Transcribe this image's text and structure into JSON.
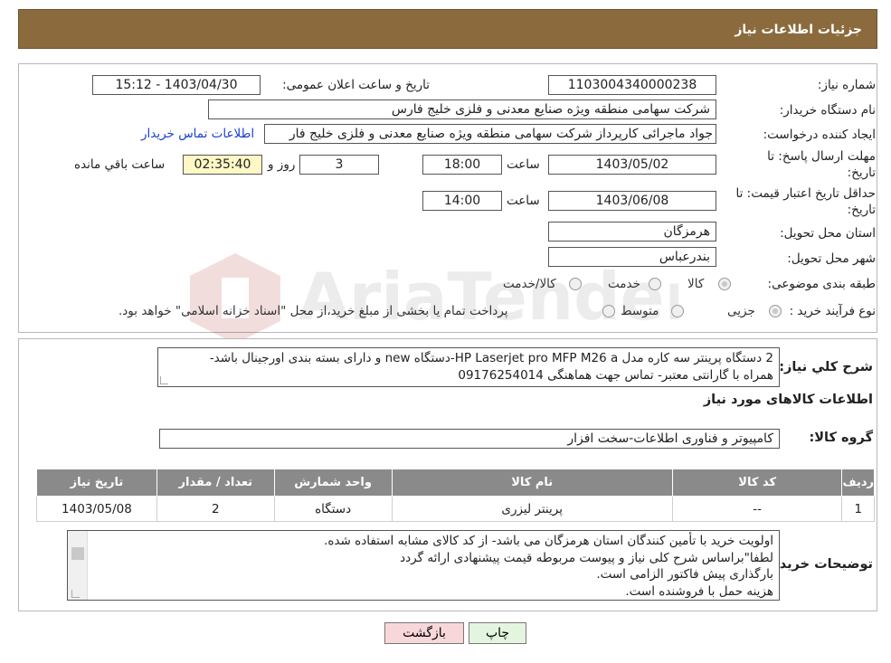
{
  "header": {
    "title": "جزئیات اطلاعات نیاز"
  },
  "form": {
    "need_number": {
      "label": "شماره نیاز:",
      "value": "1103004340000238"
    },
    "announce": {
      "label": "تاریخ و ساعت اعلان عمومی:",
      "value": "1403/04/30 - 15:12"
    },
    "buyer_org": {
      "label": "نام دستگاه خریدار:",
      "value": "شرکت سهامی منطقه ویژه صنایع معدنی و فلزی خلیج فارس"
    },
    "requester": {
      "label": "ایجاد کننده درخواست:",
      "value": "جواد ماجرائی کارپرداز شرکت سهامی منطقه ویژه صنایع معدنی و فلزی خلیج فار",
      "contact_link": "اطلاعات تماس خریدار"
    },
    "reply_deadline": {
      "label_line1": "مهلت ارسال پاسخ: تا",
      "label_line2": "تاریخ:",
      "date": "1403/05/02",
      "time_label": "ساعت",
      "time": "18:00",
      "days": "3",
      "days_label": "روز و",
      "remaining": "02:35:40",
      "remaining_label": "ساعت باقي مانده"
    },
    "price_validity": {
      "label_line1": "حداقل تاریخ اعتبار قیمت: تا",
      "label_line2": "تاریخ:",
      "date": "1403/06/08",
      "time_label": "ساعت",
      "time": "14:00"
    },
    "province": {
      "label": "استان محل تحویل:",
      "value": "هرمزگان"
    },
    "city": {
      "label": "شهر محل تحویل:",
      "value": "بندرعباس"
    },
    "category": {
      "label": "طبقه بندی موضوعی:",
      "options": [
        "کالا",
        "خدمت",
        "کالا/خدمت"
      ],
      "selected": 0
    },
    "process": {
      "label": "نوع فرآیند خرید :",
      "options": [
        "جزیی",
        "متوسط"
      ],
      "selected": 0,
      "note": "پرداخت تمام یا بخشی از مبلغ خرید،از محل \"اسناد خزانه اسلامی\" خواهد بود."
    }
  },
  "description": {
    "label": "شرح کلي نياز:",
    "line1": "2 دستگاه پرینتر سه کاره مدل  HP Laserjet pro MFP M26 a-دستگاه new و دارای بسته بندی اورجینال باشد-",
    "line2": "همراه با گارانتی معتبر- تماس جهت هماهنگی 09176254014"
  },
  "items_section": {
    "title": "اطلاعات کالاهای مورد نیاز",
    "group_label": "گروه کالا:",
    "group_value": "کامپیوتر و فناوری اطلاعات-سخت افزار",
    "columns": [
      "ردیف",
      "کد کالا",
      "نام کالا",
      "واحد شمارش",
      "تعداد / مقدار",
      "تاریخ نیاز"
    ],
    "rows": [
      [
        "1",
        "--",
        "پرینتر لیزری",
        "دستگاه",
        "2",
        "1403/05/08"
      ]
    ]
  },
  "notes": {
    "label": "توضیحات خریدار:",
    "text": "اولویت خرید با تأمین کنندگان استان هرمزگان می باشد- از کد کالای مشابه استفاده شده.\nلطفا\"براساس شرح کلی نیاز و پیوست مربوطه قیمت پیشنهادی ارائه گردد\nبارگذاری پیش فاکتور الزامی است.\nهزینه حمل با فروشنده است."
  },
  "buttons": {
    "print": "چاپ",
    "back": "بازگشت"
  },
  "watermark": {
    "text": "AriaTender.neT"
  },
  "colors": {
    "header_bg": "#8b6b3d",
    "table_header_bg": "#8a8a8a",
    "back_button_bg": "#f8d7da",
    "print_button_bg": "#e4f5df",
    "link": "#1a3fd6"
  }
}
